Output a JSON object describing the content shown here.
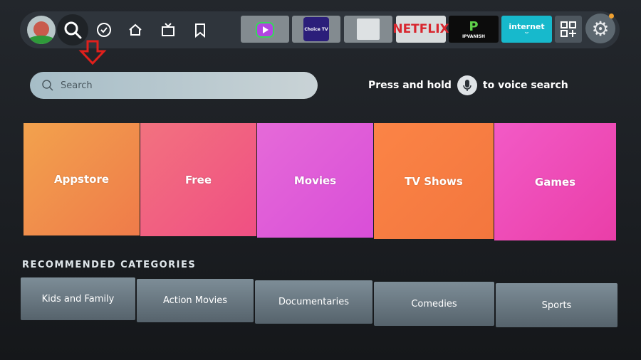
{
  "nav": {
    "items": [
      "profile",
      "search",
      "check",
      "home",
      "live-tv",
      "watchlist"
    ]
  },
  "apps": [
    {
      "name": "app-tile-1",
      "label": "",
      "bg": "#838b90"
    },
    {
      "name": "app-tile-choice-tv",
      "label": "Choice TV",
      "bg": "#838b90"
    },
    {
      "name": "app-tile-3",
      "label": "",
      "bg": "#838b90"
    },
    {
      "name": "app-tile-netflix",
      "label": "NETFLIX",
      "bg": "#d8dcdd"
    },
    {
      "name": "app-tile-ipvanish",
      "label": "IPVANISH",
      "bg": "#0c0c0c"
    },
    {
      "name": "app-tile-internet",
      "label": "internet",
      "bg": "#17b9cc"
    }
  ],
  "search": {
    "placeholder": "Search"
  },
  "voice": {
    "before": "Press and hold",
    "after": "to voice search"
  },
  "tiles": [
    {
      "label": "Appstore",
      "c1": "#f2a24d",
      "c2": "#ef7b4a"
    },
    {
      "label": "Free",
      "c1": "#f2727f",
      "c2": "#f04f83"
    },
    {
      "label": "Movies",
      "c1": "#e56ad8",
      "c2": "#d94ed8"
    },
    {
      "label": "TV Shows",
      "c1": "#fb8446",
      "c2": "#f3763e"
    },
    {
      "label": "Games",
      "c1": "#f25ac6",
      "c2": "#ea3ea8"
    }
  ],
  "recommended": {
    "title": "RECOMMENDED CATEGORIES",
    "items": [
      "Kids and Family",
      "Action Movies",
      "Documentaries",
      "Comedies",
      "Sports"
    ]
  },
  "colors": {
    "notification": "#f0a030",
    "arrow": "#e0201c"
  }
}
